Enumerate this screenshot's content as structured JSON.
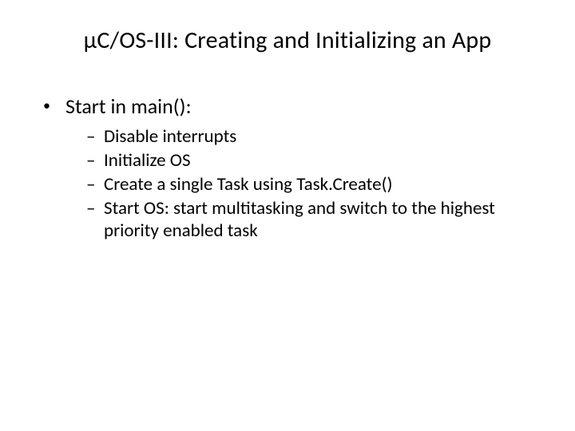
{
  "slide": {
    "title": "µC/OS-III: Creating and Initializing an App",
    "level1": {
      "bullet": "•",
      "text": "Start in main():"
    },
    "level2": [
      {
        "dash": "–",
        "text": "Disable interrupts"
      },
      {
        "dash": "–",
        "text": "Initialize OS"
      },
      {
        "dash": "–",
        "text": "Create a single Task using Task.Create()"
      },
      {
        "dash": "–",
        "text": "Start OS: start multitasking and switch to the highest priority enabled task"
      }
    ]
  }
}
